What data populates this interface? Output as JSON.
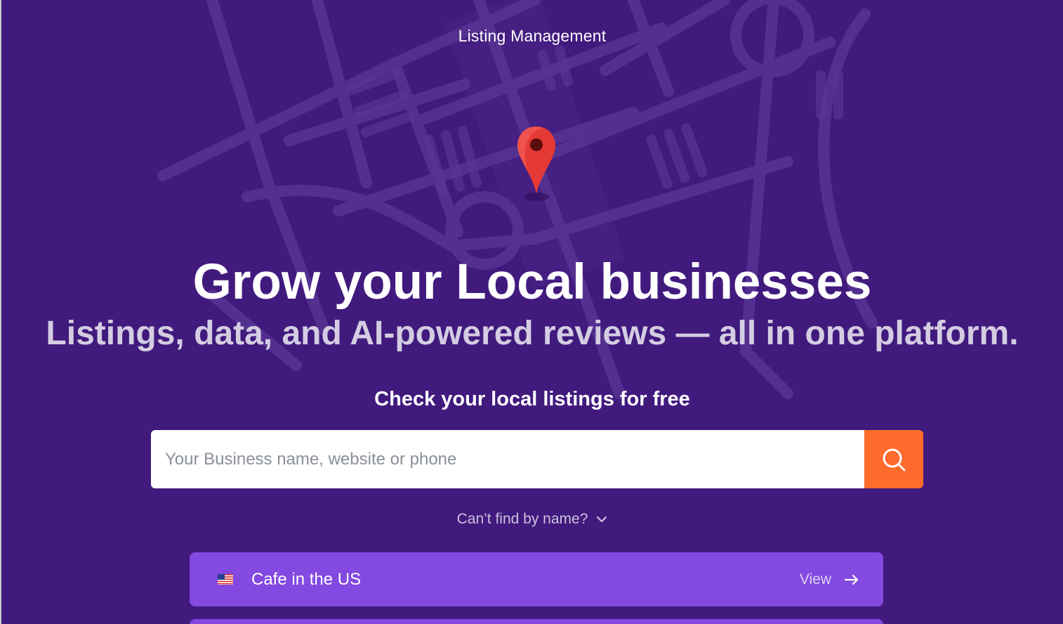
{
  "header": {
    "eyebrow": "Listing Management"
  },
  "hero": {
    "headline": "Grow your Local businesses",
    "subline": "Listings, data, and AI-powered reviews — all in one platform."
  },
  "search": {
    "title": "Check your local listings for free",
    "placeholder": "Your Business name, website or phone",
    "button_icon": "search-icon"
  },
  "cant_find": {
    "label": "Can’t find by name?",
    "icon": "chevron-down-icon"
  },
  "examples": [
    {
      "flag": "us-flag-icon",
      "label": "Cafe in the US",
      "action": "View",
      "action_icon": "arrow-right-icon"
    }
  ],
  "colors": {
    "background": "#411a7e",
    "accent": "#ff6b2c",
    "card": "#8349e0",
    "pin": "#e53935"
  }
}
